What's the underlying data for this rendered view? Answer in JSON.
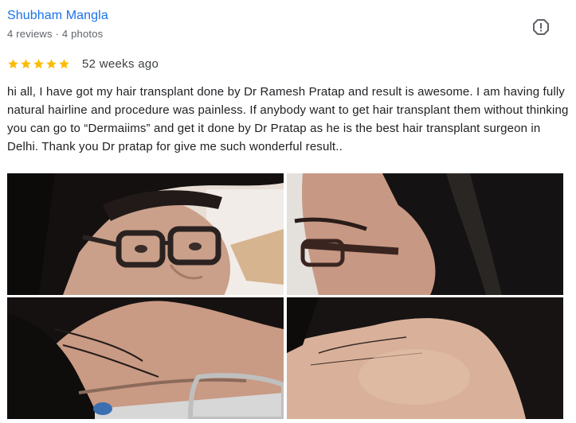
{
  "reviewer": {
    "name": "Shubham Mangla",
    "meta": "4 reviews · 4 photos"
  },
  "review": {
    "rating": 5,
    "rating_max": 5,
    "date": "52 weeks ago",
    "text": "hi all, I have got my hair transplant done by Dr Ramesh Pratap and result is awesome. I am having fully natural hairline and procedure was painless. If anybody want to get hair transplant them without thinking you can go to “Dermaiims” and get it done by Dr Pratap as he is the best hair transplant surgeon in Delhi. Thank you Dr pratap for give me such wonderful result.."
  },
  "colors": {
    "name_link": "#1a73e8",
    "star": "#fbbc04",
    "meta_text": "#5f6368",
    "body_text": "#202124",
    "flag_icon": "#5f6368"
  },
  "icons": {
    "flag": "flag-icon",
    "star": "star-icon"
  },
  "photos": [
    {
      "subject": "glasses-front"
    },
    {
      "subject": "side-profile"
    },
    {
      "subject": "temple-glasses"
    },
    {
      "subject": "forehead-hairline"
    }
  ]
}
